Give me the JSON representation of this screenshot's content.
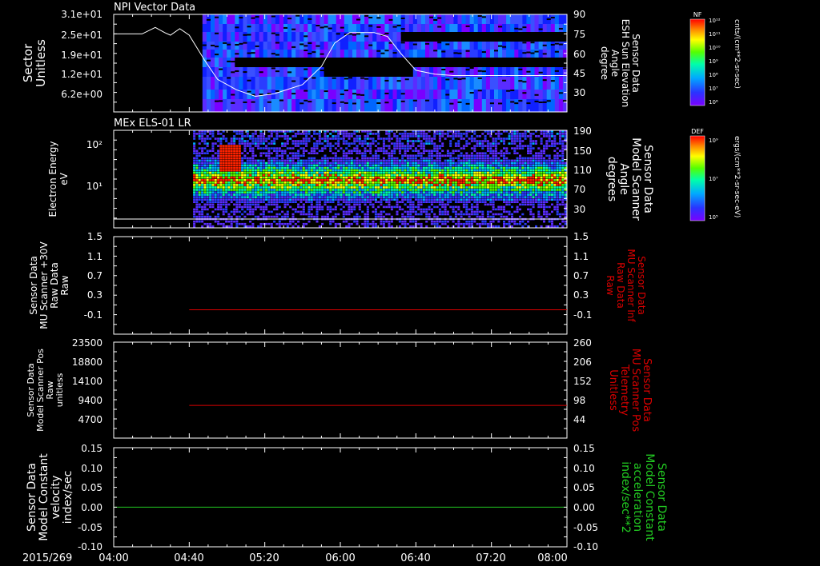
{
  "date_label": "2015/269",
  "time_axis": {
    "start": "04:00",
    "end": "08:00",
    "tick_labels": [
      "04:00",
      "04:40",
      "05:20",
      "06:00",
      "06:40",
      "07:20",
      "08:00"
    ]
  },
  "colors": {
    "red_series": "#dd0000",
    "green_series": "#22cc22",
    "frame": "#ffffff"
  },
  "chart_data": [
    {
      "type": "heatmap",
      "title": "NPI Vector Data",
      "left_axis": {
        "label_lines": [
          "Sector",
          "Unitless"
        ],
        "tick_labels": [
          "3.1e+01",
          "2.5e+01",
          "1.9e+01",
          "1.2e+01",
          "6.2e+00"
        ],
        "ylim": [
          0,
          31
        ]
      },
      "right_axis": {
        "label_lines": [
          "Sensor Data",
          "ESH Sun Elevation",
          "Angle",
          "degree"
        ],
        "tick_labels": [
          "90",
          "75",
          "60",
          "45",
          "30"
        ],
        "ylim": [
          15,
          90
        ]
      },
      "overlay_line": {
        "name_axis": "right",
        "x": [
          "04:00",
          "04:15",
          "04:22",
          "04:27",
          "04:30",
          "04:35",
          "04:40",
          "04:48",
          "04:55",
          "05:05",
          "05:15",
          "05:25",
          "05:40",
          "05:50",
          "05:57",
          "06:05",
          "06:12",
          "06:18",
          "06:25",
          "06:32",
          "06:40",
          "06:50",
          "07:00",
          "07:20",
          "08:00"
        ],
        "y": [
          75,
          75,
          80,
          76,
          74,
          79,
          74,
          55,
          40,
          32,
          27,
          29,
          36,
          50,
          68,
          76,
          76,
          76,
          73,
          60,
          47,
          44,
          43,
          43,
          43
        ]
      },
      "colorbar": {
        "label": "NF",
        "units": "cnts/(cm**2-sr-sec)",
        "tick_labels": [
          "10¹²",
          "10¹¹",
          "10¹⁰",
          "10⁹",
          "10⁸",
          "10⁷",
          "10⁶"
        ]
      }
    },
    {
      "type": "heatmap",
      "title": "MEx ELS-01 LR",
      "left_axis": {
        "label_lines": [
          "Electron Energy",
          "eV"
        ],
        "tick_labels": [
          "10²",
          "10¹"
        ],
        "scale": "log"
      },
      "right_axis": {
        "label_lines": [
          "Sensor Data",
          "Model Scanner",
          "Angle",
          "degrees"
        ],
        "tick_labels": [
          "190",
          "150",
          "110",
          "70",
          "30"
        ],
        "ylim": [
          0,
          190
        ]
      },
      "colorbar": {
        "label": "DEF",
        "units": "ergs/(cm**2-sr-sec-eV)",
        "tick_labels": [
          "10⁹",
          "10⁷",
          "10⁵"
        ]
      }
    },
    {
      "type": "line",
      "left_axis": {
        "label_lines": [
          "Sensor Data",
          "MU Scanner +30V",
          "Raw Data",
          "Raw"
        ],
        "tick_labels": [
          "1.5",
          "1.1",
          "0.7",
          "0.3",
          "-0.1"
        ],
        "ylim": [
          -0.5,
          1.5
        ]
      },
      "right_axis": {
        "label_lines": [
          "Sensor Data",
          "MU Scanner Inf",
          "Raw Data",
          "Raw"
        ],
        "tick_labels": [
          "1.5",
          "1.1",
          "0.7",
          "0.3",
          "-0.1"
        ],
        "ylim": [
          -0.5,
          1.5
        ]
      },
      "series": [
        {
          "color": "#dd0000",
          "x": [
            "04:40",
            "08:00"
          ],
          "values": [
            0.0,
            0.0
          ]
        }
      ]
    },
    {
      "type": "line",
      "left_axis": {
        "label_lines": [
          "Sensor Data",
          "Model Scanner Pos",
          "Raw",
          "unitless"
        ],
        "tick_labels": [
          "23500",
          "18800",
          "14100",
          "9400",
          "4700"
        ],
        "ylim": [
          0,
          23500
        ]
      },
      "right_axis": {
        "label_lines": [
          "Sensor Data",
          "MU Scanner Pos",
          "Telemetry",
          "Unitless"
        ],
        "tick_labels": [
          "260",
          "206",
          "152",
          "98",
          "44"
        ],
        "ylim": [
          0,
          260
        ]
      },
      "series": [
        {
          "color": "#dd0000",
          "x": [
            "04:40",
            "08:00"
          ],
          "values": [
            8000,
            8000
          ]
        }
      ]
    },
    {
      "type": "line",
      "left_axis": {
        "label_lines": [
          "Sensor Data",
          "Model Constant",
          "velocity",
          "index/sec"
        ],
        "tick_labels": [
          "0.15",
          "0.10",
          "0.05",
          "0.00",
          "-0.05",
          "-0.10"
        ],
        "ylim": [
          -0.1,
          0.15
        ]
      },
      "right_axis": {
        "label_lines": [
          "Sensor Data",
          "Model Constant",
          "acceleration",
          "index/sec**2"
        ],
        "tick_labels": [
          "0.15",
          "0.10",
          "0.05",
          "0.00",
          "-0.05",
          "-0.10"
        ],
        "ylim": [
          -0.1,
          0.15
        ]
      },
      "series": [
        {
          "color": "#22cc22",
          "x": [
            "04:00",
            "08:00"
          ],
          "values": [
            0.0,
            0.0
          ]
        }
      ]
    }
  ]
}
